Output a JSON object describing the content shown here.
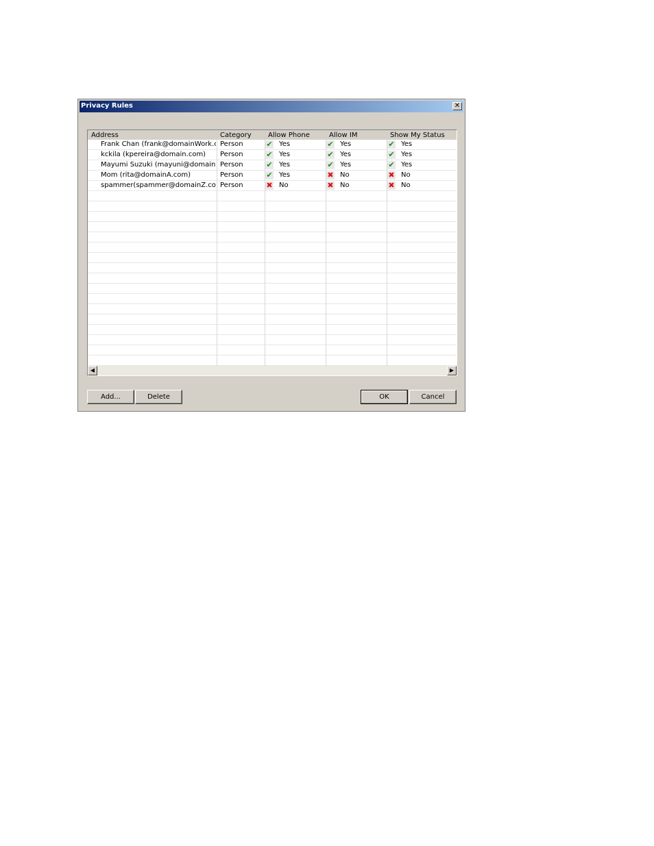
{
  "dialog": {
    "title": "Privacy Rules",
    "close_glyph": "✕"
  },
  "columns": [
    "Address",
    "Category",
    "Allow Phone",
    "Allow IM",
    "Show My Status"
  ],
  "rows": [
    {
      "address": "Frank Chan (frank@domainWork.c...",
      "category": "Person",
      "phone": {
        "state": "yes",
        "label": "Yes"
      },
      "im": {
        "state": "yes",
        "label": "Yes"
      },
      "status": {
        "state": "yes",
        "label": "Yes"
      }
    },
    {
      "address": "kckila (kpereira@domain.com)",
      "category": "Person",
      "phone": {
        "state": "yes",
        "label": "Yes"
      },
      "im": {
        "state": "yes",
        "label": "Yes"
      },
      "status": {
        "state": "yes",
        "label": "Yes"
      }
    },
    {
      "address": "Mayumi Suzuki (mayuni@domain...",
      "category": "Person",
      "phone": {
        "state": "yes",
        "label": "Yes"
      },
      "im": {
        "state": "yes",
        "label": "Yes"
      },
      "status": {
        "state": "yes",
        "label": "Yes"
      }
    },
    {
      "address": "Mom (rita@domainA.com)",
      "category": "Person",
      "phone": {
        "state": "yes",
        "label": "Yes"
      },
      "im": {
        "state": "no",
        "label": "No"
      },
      "status": {
        "state": "no",
        "label": "No"
      }
    },
    {
      "address": "spammer(spammer@domainZ.com)",
      "category": "Person",
      "phone": {
        "state": "no",
        "label": "No"
      },
      "im": {
        "state": "no",
        "label": "No"
      },
      "status": {
        "state": "no",
        "label": "No"
      }
    }
  ],
  "icons": {
    "yes": "checkmark-icon",
    "no": "x-mark-icon"
  },
  "colors": {
    "title_start": "#0a246a",
    "title_end": "#a6caf0",
    "yes": "#1a8a1a",
    "no": "#dd1111",
    "face": "#d4d0c8"
  },
  "buttons": {
    "add": "Add...",
    "delete": "Delete",
    "ok": "OK",
    "cancel": "Cancel"
  }
}
